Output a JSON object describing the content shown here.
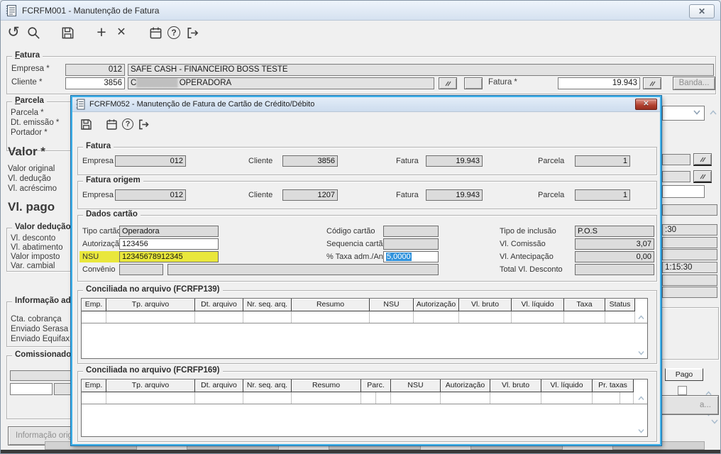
{
  "glyphs": {
    "plus": "+",
    "delete": "✕",
    "close": "✕"
  },
  "colors": {
    "window_bg": "#f0f0f0",
    "titlebar_top": "#eef4fb",
    "titlebar_bottom": "#d5e1f0",
    "modal_border": "#3fb0e8",
    "highlight_yellow": "#e9e73c",
    "selection_blue": "#3092dc",
    "close_button_red": "#b2402f",
    "field_gray": "#e2e2e2"
  },
  "main_window": {
    "title": "FCRFM001 - Manutenção de Fatura",
    "toolbar_icons": [
      "undo",
      "search",
      "save",
      "add",
      "delete",
      "calendar",
      "help",
      "exit"
    ],
    "fatura_group": {
      "label": "Fatura",
      "empresa_label": "Empresa *",
      "empresa_code": "012",
      "empresa_desc": "SAFE CASH - FINANCEIRO BOSS TESTE",
      "cliente_label": "Cliente *",
      "cliente_code": "3856",
      "cliente_desc_start": "C",
      "cliente_desc_redacted": "████████",
      "cliente_desc_end": " OPERADORA",
      "fatura_label": "Fatura *",
      "fatura_value": "19.943",
      "banda_button": "Banda..."
    },
    "sidebar": {
      "parcela_group": {
        "label": "Parcela",
        "items": [
          "Parcela *",
          "Dt. emissão *",
          "Portador *"
        ]
      },
      "valor_heading": "Valor *",
      "valor_items": [
        "Valor original",
        "Vl. dedução",
        "Vl. acréscimo"
      ],
      "vl_pago_heading": "Vl. pago",
      "valor_deducao_group": {
        "label": "Valor dedução",
        "items": [
          "Vl. desconto",
          "Vl. abatimento",
          "Valor imposto",
          "Var. cambial"
        ]
      },
      "info_adicional_group": {
        "label": "Informação adic",
        "items": [
          "Cta. cobrança",
          "Enviado Serasa",
          "Enviado Equifax"
        ]
      },
      "comissionado_group": {
        "label": "Comissionado"
      },
      "info_origem_button": "Informação orige"
    },
    "background_right": {
      "time_field_1": ":30",
      "time_field_2": "1:15:30",
      "pago_header": "Pago",
      "partial_button": "a..."
    }
  },
  "modal": {
    "title": "FCRFM052 - Manutenção de Fatura de Cartão de Crédito/Débito",
    "toolbar_icons": [
      "save",
      "calendar",
      "help",
      "exit"
    ],
    "fatura_group": {
      "label": "Fatura",
      "fields": [
        {
          "label": "Empresa",
          "value": "012"
        },
        {
          "label": "Cliente",
          "value": "3856"
        },
        {
          "label": "Fatura",
          "value": "19.943"
        },
        {
          "label": "Parcela",
          "value": "1"
        }
      ]
    },
    "fatura_origem_group": {
      "label": "Fatura origem",
      "fields": [
        {
          "label": "Empresa",
          "value": "012"
        },
        {
          "label": "Cliente",
          "value": "1207"
        },
        {
          "label": "Fatura",
          "value": "19.943"
        },
        {
          "label": "Parcela",
          "value": "1"
        }
      ]
    },
    "dados_cartao_group": {
      "label": "Dados cartão",
      "tipo_cartao_label": "Tipo cartão",
      "tipo_cartao_value": "Operadora",
      "autorizacao_label": "Autorização",
      "autorizacao_value": "123456",
      "nsu_label": "NSU",
      "nsu_value": "12345678912345",
      "convenio_label": "Convênio",
      "convenio_code": "",
      "convenio_desc": "",
      "codigo_cartao_label": "Código cartão",
      "codigo_cartao_value": "",
      "sequencia_cartao_label": "Sequencia cartão",
      "sequencia_cartao_value": "",
      "taxa_label": "% Taxa adm./Antec.",
      "taxa_value": "5,0000",
      "tipo_inclusao_label": "Tipo de inclusão",
      "tipo_inclusao_value": "P.O.S",
      "vl_comissao_label": "Vl. Comissão",
      "vl_comissao_value": "3,07",
      "vl_antecipacao_label": "Vl. Antecipação",
      "vl_antecipacao_value": "0,00",
      "total_desconto_label": "Total Vl. Desconto",
      "total_desconto_value": ""
    },
    "table_139": {
      "title": "Conciliada no arquivo (FCRFP139)",
      "columns": [
        "Emp.",
        "Tp. arquivo",
        "Dt. arquivo",
        "Nr. seq. arq.",
        "Resumo",
        "NSU",
        "Autorização",
        "Vl. bruto",
        "Vl. líquido",
        "Taxa",
        "Status"
      ]
    },
    "table_169": {
      "title": "Conciliada no arquivo (FCRFP169)",
      "columns": [
        "Emp.",
        "Tp. arquivo",
        "Dt. arquivo",
        "Nr. seq. arq.",
        "Resumo",
        "Parc.",
        "NSU",
        "Autorização",
        "Vl. bruto",
        "Vl. líquido",
        "Pr. taxas"
      ]
    }
  }
}
